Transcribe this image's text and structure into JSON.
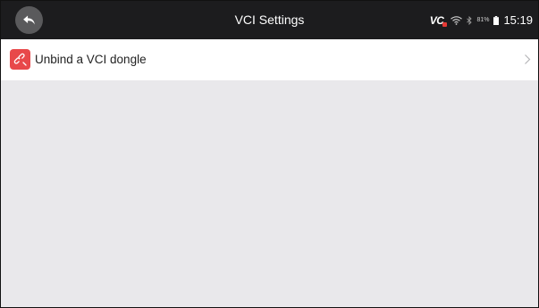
{
  "header": {
    "title": "VCI Settings",
    "back_icon": "back-arrow-icon"
  },
  "status_bar": {
    "vci_label": "VC",
    "vci_indicator_color": "#e53935",
    "battery_percent": "81%",
    "time": "15:19"
  },
  "list": {
    "items": [
      {
        "label": "Unbind a VCI dongle",
        "icon": "unlink-icon",
        "icon_color": "#e8484a"
      }
    ]
  },
  "colors": {
    "top_bar": "#1c1c1e",
    "background": "#e9e8eb",
    "accent": "#e8484a"
  }
}
